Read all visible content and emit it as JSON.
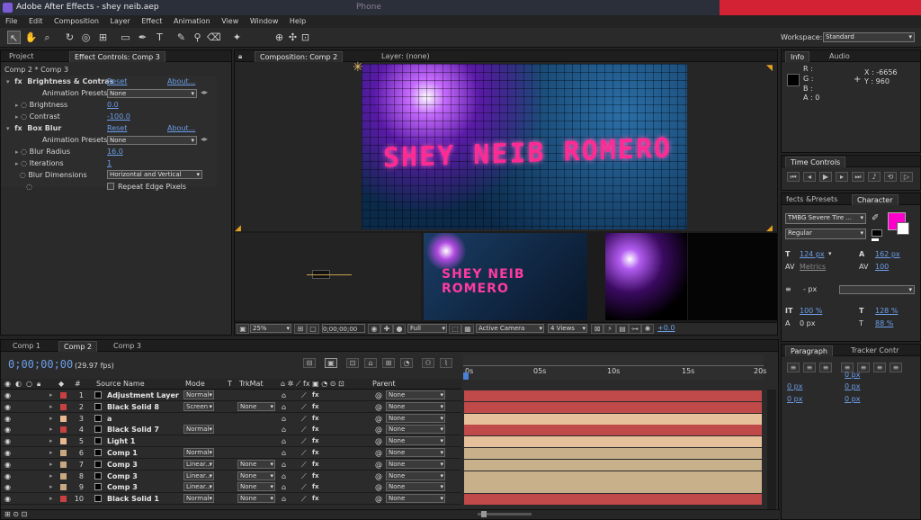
{
  "window": {
    "title": "Adobe After Effects - shey neib.aep",
    "faded_title": "Phone"
  },
  "menu": [
    "File",
    "Edit",
    "Composition",
    "Layer",
    "Effect",
    "Animation",
    "View",
    "Window",
    "Help"
  ],
  "workspace": {
    "label": "Workspace:",
    "value": "Standard"
  },
  "effect_panel": {
    "tab_project": "Project",
    "tab_effects": "Effect Controls: Comp 3",
    "breadcrumb": "Comp 2 * Comp 3",
    "fx1": {
      "name": "Brightness & Contras",
      "reset": "Reset",
      "about": "About...",
      "presets_label": "Animation Presets:",
      "presets_value": "None",
      "p1_label": "Brightness",
      "p1_value": "0.0",
      "p2_label": "Contrast",
      "p2_value": "-100.0"
    },
    "fx2": {
      "name": "Box Blur",
      "reset": "Reset",
      "about": "About...",
      "presets_label": "Animation Presets:",
      "presets_value": "None",
      "p1_label": "Blur Radius",
      "p1_value": "16.0",
      "p2_label": "Iterations",
      "p2_value": "1",
      "p3_label": "Blur Dimensions",
      "p3_value": "Horizontal and Vertical",
      "p4_label": "Repeat Edge Pixels"
    }
  },
  "comp_panel": {
    "tab_comp": "Composition: Comp 2",
    "tab_layer": "Layer: (none)",
    "preview_text": "SHEY NEIB ROMERO",
    "zoom": "25%",
    "timecode": "0;00;00;00",
    "quality": "Full",
    "camera": "Active Camera",
    "views": "4 Views",
    "exposure": "+0.0"
  },
  "info": {
    "tab_info": "Info",
    "tab_audio": "Audio",
    "r": "R :",
    "g": "G :",
    "b": "B :",
    "a": "A : 0",
    "x": "X : -6656",
    "y": "Y : 960"
  },
  "time_controls": {
    "title": "Time Controls"
  },
  "character": {
    "tab_effects": "fects &Presets",
    "tab_char": "Character",
    "font": "TMBG Severe Tire ...",
    "style": "Regular",
    "size": "124 px",
    "leading": "162 px",
    "kerning": "Metrics",
    "tracking": "100",
    "stroke": "- px",
    "vscale": "100 %",
    "hscale": "128 %",
    "baseline": "0 px",
    "tsume": "88 %",
    "fill_color": "#ff00cc"
  },
  "paragraph": {
    "tab": "Paragraph",
    "tab2": "Tracker Contr",
    "indent1": "0 px",
    "indent2": "0 px",
    "indent3": "0 px",
    "space1": "0 px",
    "space2": "0 px"
  },
  "timeline": {
    "tabs": [
      "Comp 1",
      "Comp 2",
      "Comp 3"
    ],
    "timecode": "0;00;00;00",
    "fps": "(29.97 fps)",
    "headers": {
      "num": "#",
      "source": "Source Name",
      "mode": "Mode",
      "t": "T",
      "trkmat": "TrkMat",
      "parent": "Parent"
    },
    "ruler": [
      "0s",
      "05s",
      "10s",
      "15s",
      "20s"
    ],
    "layers": [
      {
        "num": "1",
        "name": "Adjustment Layer",
        "mode": "Normal",
        "trk": "",
        "parent": "None",
        "label": "#c84040",
        "bar": "#c04a4a"
      },
      {
        "num": "2",
        "name": "Black Solid 8",
        "mode": "Screen",
        "trk": "None",
        "parent": "None",
        "label": "#c84040",
        "bar": "#c04a4a"
      },
      {
        "num": "3",
        "name": "a",
        "mode": "",
        "trk": "",
        "parent": "None",
        "label": "#e8b890",
        "bar": "#e6c09a"
      },
      {
        "num": "4",
        "name": "Black Solid 7",
        "mode": "Normal",
        "trk": "",
        "parent": "None",
        "label": "#c84040",
        "bar": "#c04a4a"
      },
      {
        "num": "5",
        "name": "Light 1",
        "mode": "",
        "trk": "",
        "parent": "None",
        "label": "#e8b890",
        "bar": "#e6c09a"
      },
      {
        "num": "6",
        "name": "Comp 1",
        "mode": "Normal",
        "trk": "",
        "parent": "None",
        "label": "#c8a880",
        "bar": "#c8b08a"
      },
      {
        "num": "7",
        "name": "Comp 3",
        "mode": "Linear...",
        "trk": "None",
        "parent": "None",
        "label": "#c8a880",
        "bar": "#c8b08a"
      },
      {
        "num": "8",
        "name": "Comp 3",
        "mode": "Linear...",
        "trk": "None",
        "parent": "None",
        "label": "#c8a880",
        "bar": "#c8b08a"
      },
      {
        "num": "9",
        "name": "Comp 3",
        "mode": "Linear...",
        "trk": "None",
        "parent": "None",
        "label": "#c8a880",
        "bar": "#c8b08a"
      },
      {
        "num": "10",
        "name": "Black Solid 1",
        "mode": "Normal",
        "trk": "None",
        "parent": "None",
        "label": "#c84040",
        "bar": "#c04a4a"
      }
    ]
  }
}
